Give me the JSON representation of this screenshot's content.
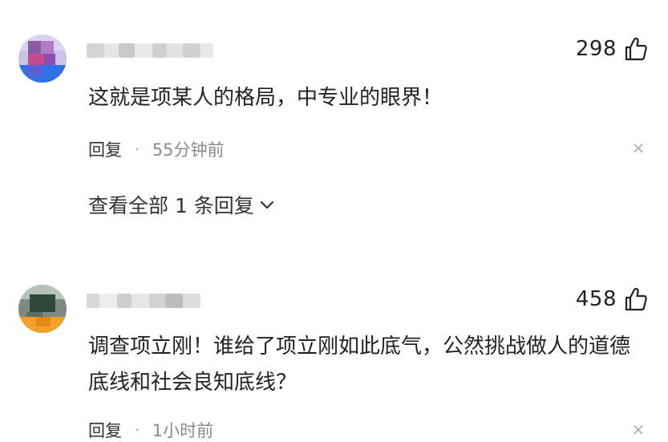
{
  "comments": [
    {
      "likes": "298",
      "text": "这就是项某人的格局，中专业的眼界！",
      "reply_label": "回复",
      "separator": "·",
      "time": "55分钟前",
      "expand_replies": "查看全部 1 条回复"
    },
    {
      "likes": "458",
      "text": "调查项立刚！谁给了项立刚如此底气，公然挑战做人的道德底线和社会良知底线？",
      "reply_label": "回复",
      "separator": "·",
      "time": "1小时前"
    }
  ],
  "icons": {
    "like": "thumbs-up-icon",
    "close": "close-icon",
    "expand": "chevron-down-icon"
  },
  "colors": {
    "text": "#222222",
    "meta": "#8a8a8a",
    "close": "#b5b5b5"
  }
}
